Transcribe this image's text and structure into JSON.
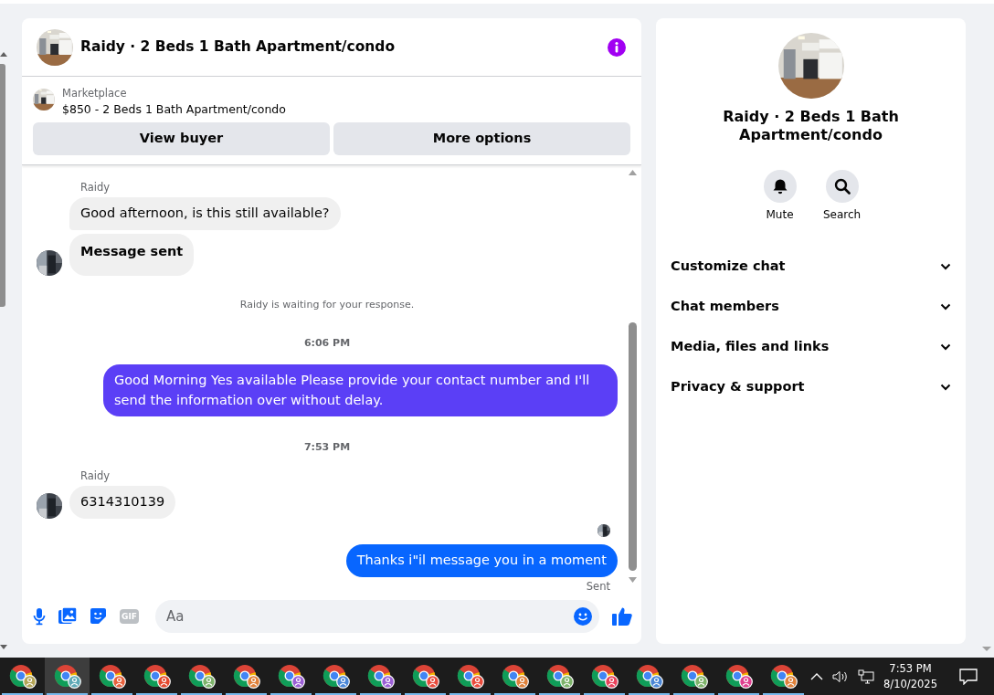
{
  "conversation": {
    "title": "Raidy · 2 Beds 1 Bath Apartment/condo"
  },
  "listing": {
    "source": "Marketplace",
    "summary": "$850 - 2 Beds 1 Bath Apartment/condo",
    "buttons": [
      "View buyer",
      "More options"
    ]
  },
  "messages": [
    {
      "kind": "sender",
      "text": "Raidy"
    },
    {
      "kind": "incoming",
      "text": "Good afternoon, is this still available?",
      "bold": false,
      "avatar": false
    },
    {
      "kind": "incoming",
      "text": "Message sent",
      "bold": true,
      "avatar": true
    },
    {
      "kind": "notice",
      "text": "Raidy is waiting for your response."
    },
    {
      "kind": "time",
      "text": "6:06 PM"
    },
    {
      "kind": "outgoing",
      "text": "Good Morning Yes available Please provide your contact number and I'll send the information over without delay.",
      "color": "#5b3ff6"
    },
    {
      "kind": "time",
      "text": "7:53 PM"
    },
    {
      "kind": "sender",
      "text": "Raidy"
    },
    {
      "kind": "incoming",
      "text": "6314310139",
      "bold": false,
      "avatar": true
    },
    {
      "kind": "seen"
    },
    {
      "kind": "outgoing",
      "text": "Thanks i\"il message you in a moment",
      "color": "#0866ff"
    },
    {
      "kind": "status",
      "text": "Sent"
    }
  ],
  "composer": {
    "gif_label": "GIF",
    "placeholder": "Aa"
  },
  "details": {
    "title": "Raidy · 2 Beds 1 Bath Apartment/condo",
    "actions": [
      {
        "kind": "mute",
        "label": "Mute"
      },
      {
        "kind": "search",
        "label": "Search"
      }
    ],
    "sections": [
      {
        "label": "Customize chat",
        "expanded": false
      },
      {
        "label": "Chat members",
        "expanded": false
      },
      {
        "label": "Media, files and links",
        "expanded": false
      },
      {
        "label": "Privacy & support",
        "expanded": false
      }
    ]
  },
  "taskbar": {
    "apps": [
      {
        "selected": false,
        "color": "#b3a455"
      },
      {
        "selected": true,
        "color": "#5fa9b6"
      },
      {
        "selected": false,
        "color": "#e8613c"
      },
      {
        "selected": false,
        "color": "#e4492e"
      },
      {
        "selected": false,
        "color": "#7db36a"
      },
      {
        "selected": false,
        "color": "#e0813a"
      },
      {
        "selected": false,
        "color": "#9b5fd6"
      },
      {
        "selected": false,
        "color": "#4a86d6"
      },
      {
        "selected": false,
        "color": "#9b5fd6"
      },
      {
        "selected": false,
        "color": "#e94b3c"
      },
      {
        "selected": false,
        "color": "#e94b3c"
      },
      {
        "selected": false,
        "color": "#e0813a"
      },
      {
        "selected": false,
        "color": "#7db36a"
      },
      {
        "selected": false,
        "color": "#e8415a"
      },
      {
        "selected": false,
        "color": "#4a86d6"
      },
      {
        "selected": false,
        "color": "#7db36a"
      },
      {
        "selected": false,
        "color": "#e03f8f"
      },
      {
        "selected": false,
        "color": "#e0813a"
      }
    ],
    "clock": {
      "time": "7:53 PM",
      "date": "8/10/2025"
    }
  }
}
